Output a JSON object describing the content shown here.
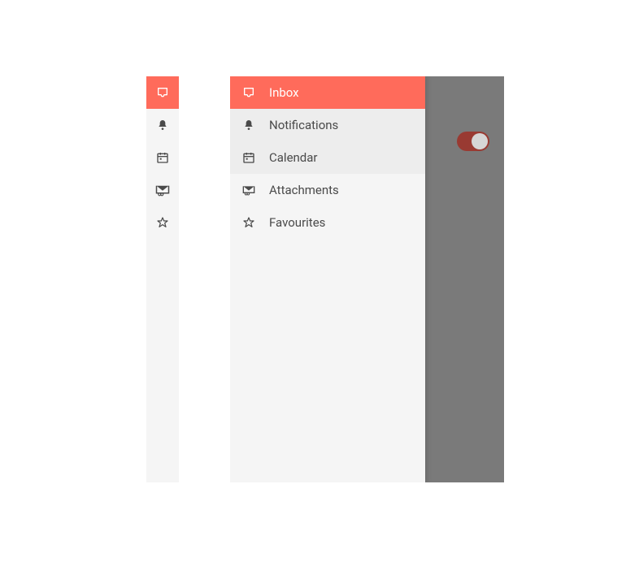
{
  "colors": {
    "accent": "#ff6b5b",
    "rail_bg": "#f5f5f5",
    "content_bg": "#7a7a7a",
    "text": "#4a4a4a"
  },
  "nav": {
    "items": [
      {
        "icon": "inbox-icon",
        "label": "Inbox",
        "active": true,
        "alt": false
      },
      {
        "icon": "bell-icon",
        "label": "Notifications",
        "active": false,
        "alt": true
      },
      {
        "icon": "calendar-icon",
        "label": "Calendar",
        "active": false,
        "alt": true
      },
      {
        "icon": "attachments-icon",
        "label": "Attachments",
        "active": false,
        "alt": false
      },
      {
        "icon": "star-icon",
        "label": "Favourites",
        "active": false,
        "alt": false
      }
    ]
  },
  "toggle": {
    "on": true
  }
}
